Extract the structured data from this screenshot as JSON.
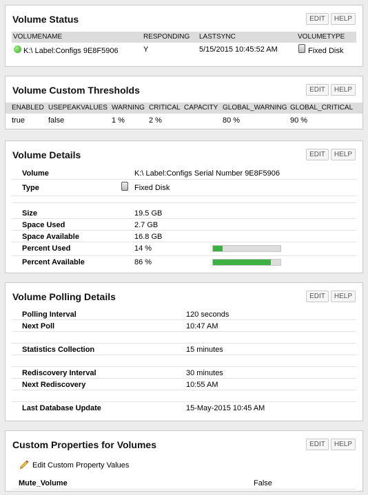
{
  "volume_status": {
    "title": "Volume Status",
    "edit": "EDIT",
    "help": "HELP",
    "columns": [
      "VOLUMENAME",
      "RESPONDING",
      "LASTSYNC",
      "VOLUMETYPE"
    ],
    "row": {
      "name": "K:\\ Label:Configs 9E8F5906",
      "responding": "Y",
      "lastsync": "5/15/2015 10:45:52 AM",
      "type": "Fixed Disk"
    }
  },
  "thresholds": {
    "title": "Volume Custom Thresholds",
    "edit": "EDIT",
    "help": "HELP",
    "columns": [
      "ENABLED",
      "USEPEAKVALUES",
      "WARNING",
      "CRITICAL",
      "CAPACITY",
      "GLOBAL_WARNING",
      "GLOBAL_CRITICAL"
    ],
    "row": {
      "enabled": "true",
      "usepeak": "false",
      "warning": "1 %",
      "critical": "2 %",
      "capacity": "",
      "global_warning": "80 %",
      "global_critical": "90 %"
    }
  },
  "details": {
    "title": "Volume Details",
    "edit": "EDIT",
    "help": "HELP",
    "volume_label": "Volume",
    "volume_value": "K:\\ Label:Configs Serial Number 9E8F5906",
    "type_label": "Type",
    "type_value": "Fixed Disk",
    "size_label": "Size",
    "size_value": "19.5 GB",
    "used_label": "Space Used",
    "used_value": "2.7 GB",
    "avail_label": "Space Available",
    "avail_value": "16.8 GB",
    "pct_used_label": "Percent Used",
    "pct_used_value": "14 %",
    "pct_used": 14,
    "pct_avail_label": "Percent Available",
    "pct_avail_value": "86 %",
    "pct_avail": 86
  },
  "polling": {
    "title": "Volume Polling Details",
    "edit": "EDIT",
    "help": "HELP",
    "interval_label": "Polling Interval",
    "interval_value": "120 seconds",
    "next_poll_label": "Next Poll",
    "next_poll_value": "10:47 AM",
    "stats_label": "Statistics Collection",
    "stats_value": "15 minutes",
    "redisc_label": "Rediscovery Interval",
    "redisc_value": "30 minutes",
    "next_redisc_label": "Next Rediscovery",
    "next_redisc_value": "10:55 AM",
    "db_label": "Last Database Update",
    "db_value": "15-May-2015 10:45 AM"
  },
  "custom_props": {
    "title": "Custom Properties for Volumes",
    "edit": "EDIT",
    "help": "HELP",
    "edit_link": "Edit Custom Property Values",
    "prop_label": "Mute_Volume",
    "prop_value": "False"
  },
  "colors": {
    "progress_fill": "#3cb043",
    "status_up": "#32a81e"
  }
}
